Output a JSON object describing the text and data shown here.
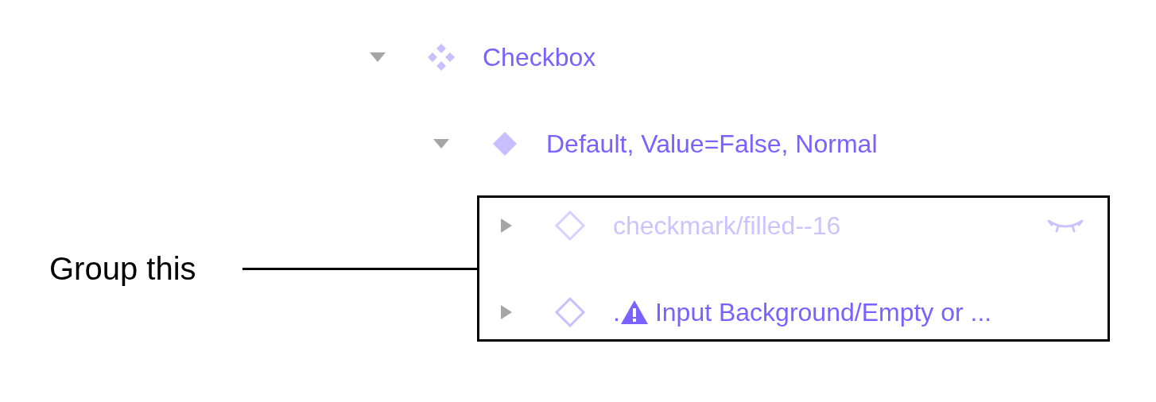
{
  "annotation": {
    "label": "Group this"
  },
  "layers": [
    {
      "kind": "component_set",
      "name": "Checkbox",
      "expanded": true,
      "children": [
        {
          "kind": "variant",
          "name": "Default, Value=False, Normal",
          "expanded": true,
          "children": [
            {
              "kind": "instance",
              "name": "checkmark/filled--16",
              "expanded": false,
              "hidden": true,
              "warning": false
            },
            {
              "kind": "instance",
              "prefix": ".",
              "name": "Input Background/Empty or ...",
              "expanded": false,
              "hidden": false,
              "warning": true
            }
          ]
        }
      ]
    }
  ]
}
